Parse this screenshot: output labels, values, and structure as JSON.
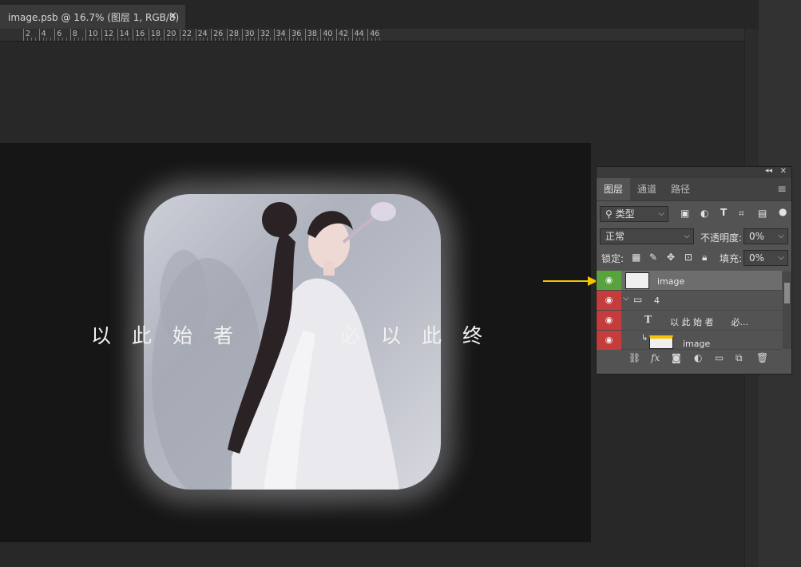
{
  "document_tab": {
    "title": "image.psb @ 16.7% (图层 1, RGB/8)",
    "close_icon": "✕"
  },
  "ruler": {
    "labels": [
      "2",
      "4",
      "6",
      "8",
      "10",
      "12",
      "14",
      "16",
      "18",
      "20",
      "22",
      "24",
      "26",
      "28",
      "30",
      "32",
      "34",
      "36",
      "38",
      "40",
      "42",
      "44",
      "46"
    ]
  },
  "canvas": {
    "text_left": "以此始者",
    "text_right": "必以此终"
  },
  "layers_panel": {
    "tabs": [
      "图层",
      "通道",
      "路径"
    ],
    "menu_icon": "≡",
    "filter_kind": "类型",
    "blend_mode": "正常",
    "opacity_label": "不透明度:",
    "opacity_value": "0%",
    "lock_label": "锁定:",
    "fill_label": "填充:",
    "fill_value": "0%",
    "layers": [
      {
        "name": "image",
        "type": "smart-object",
        "selected": true
      },
      {
        "name": "4",
        "type": "group"
      },
      {
        "name": "以 此 始 者　　必...",
        "type": "text"
      },
      {
        "name": "image",
        "type": "smart-object-clipped"
      }
    ],
    "footer_icons": [
      "link-icon",
      "fx-icon",
      "mask-icon",
      "adjustment-icon",
      "folder-icon",
      "new-layer-icon",
      "trash-icon"
    ]
  },
  "colors": {
    "accent_arrow": "#f5c400",
    "eye_red": "#c53c3c",
    "eye_green": "#59a33e",
    "selected_layer": "#6d6d6d"
  }
}
